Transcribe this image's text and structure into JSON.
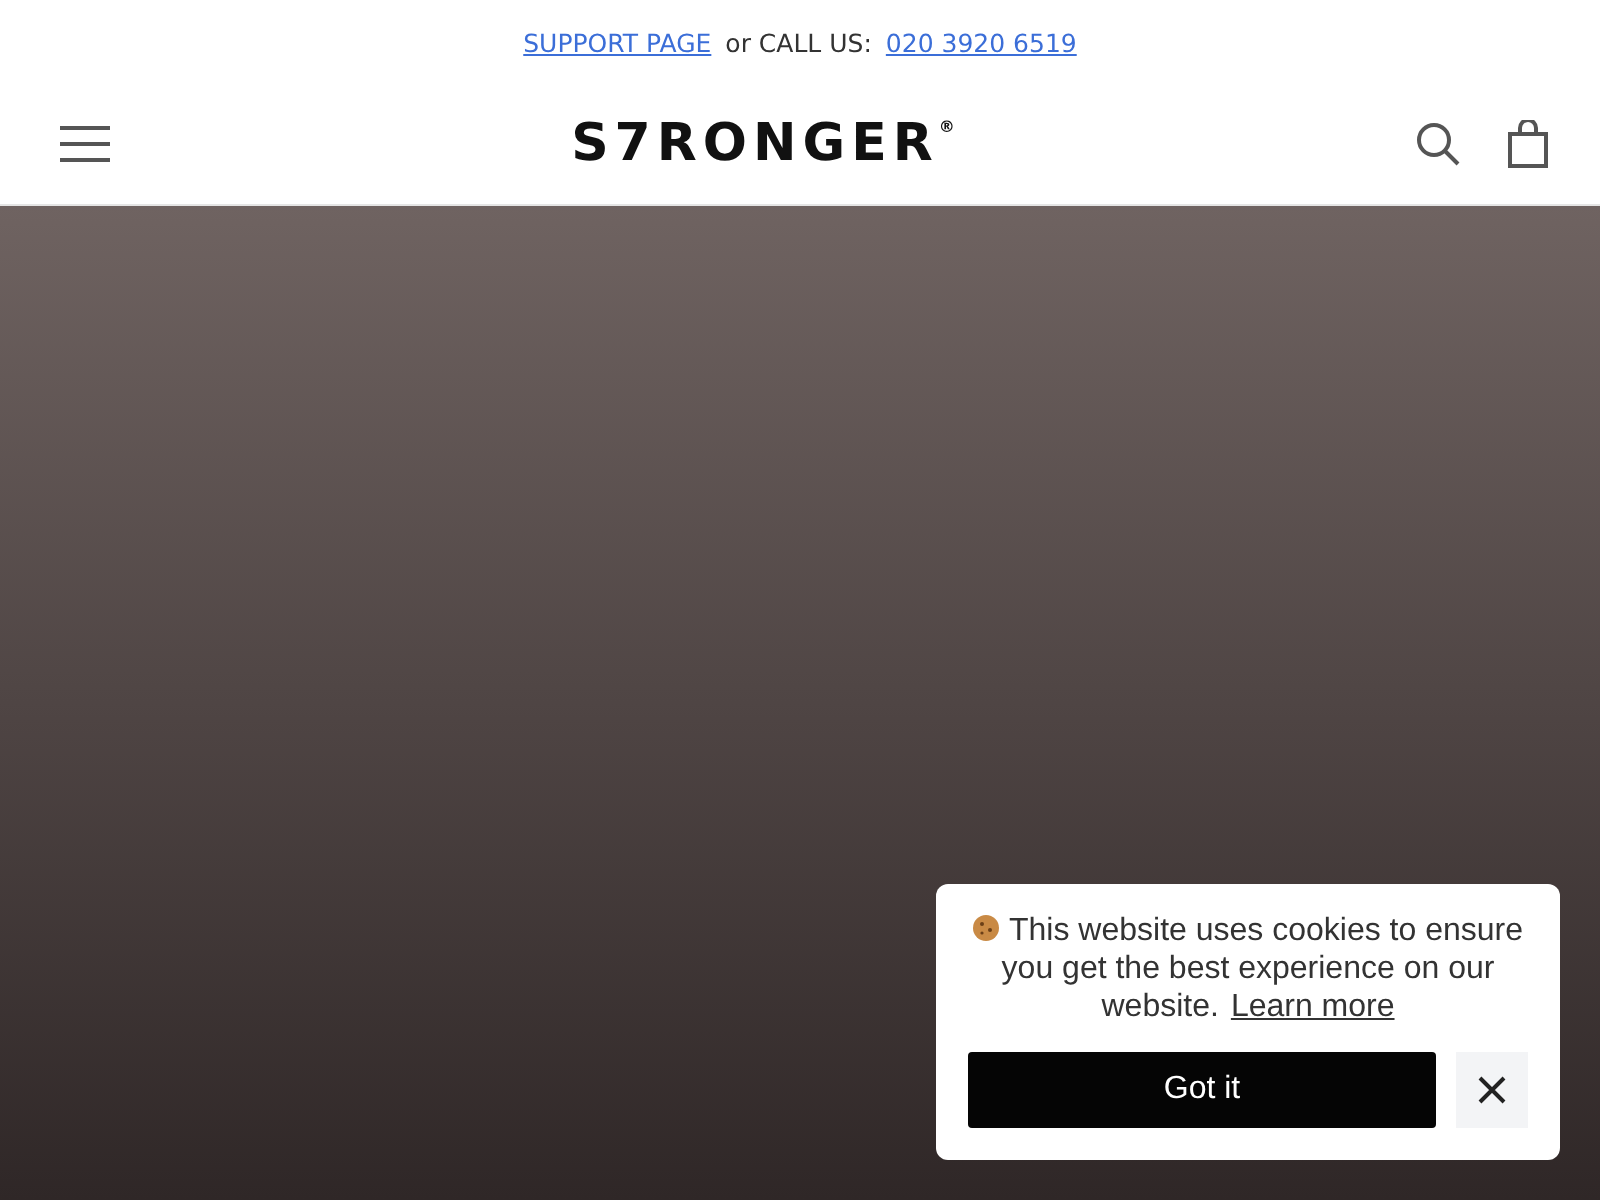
{
  "announcement": {
    "support_link": "SUPPORT PAGE",
    "call_text": "or CALL US:",
    "phone_link": "020 3920 6519"
  },
  "header": {
    "logo": "S7RONGER",
    "logo_mark": "®"
  },
  "cookie_banner": {
    "message": "This website uses cookies to ensure you get the best experience on our website.",
    "learn_more": "Learn more",
    "accept_button": "Got it"
  }
}
